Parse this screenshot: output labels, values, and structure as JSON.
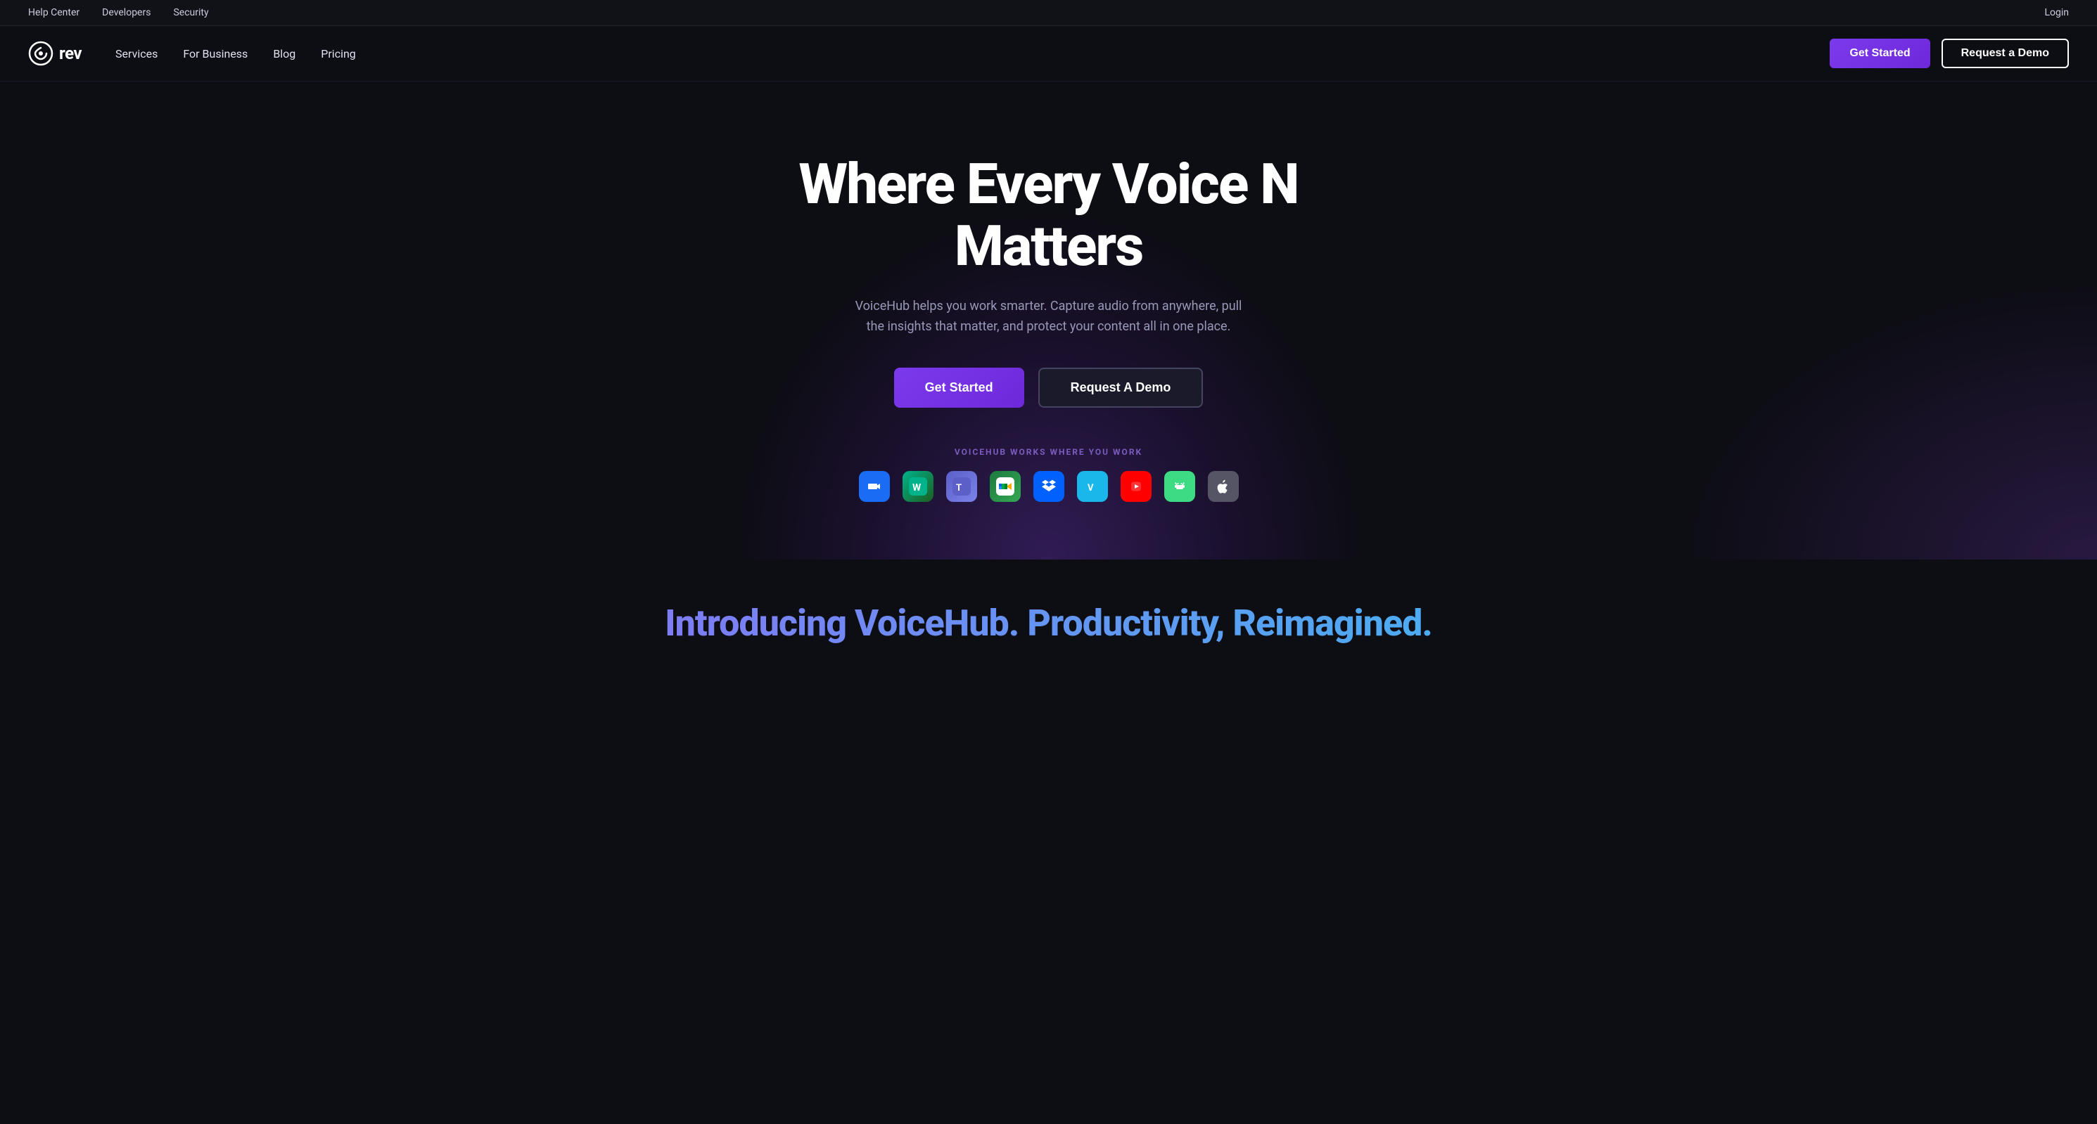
{
  "top_bar": {
    "links": [
      {
        "label": "Help Center",
        "name": "help-center-link"
      },
      {
        "label": "Developers",
        "name": "developers-link"
      },
      {
        "label": "Security",
        "name": "security-link"
      }
    ],
    "login_label": "Login"
  },
  "nav": {
    "logo_text": "rev",
    "links": [
      {
        "label": "Services",
        "name": "services-link"
      },
      {
        "label": "For Business",
        "name": "for-business-link"
      },
      {
        "label": "Blog",
        "name": "blog-link"
      },
      {
        "label": "Pricing",
        "name": "pricing-link"
      }
    ],
    "cta_primary": "Get Started",
    "cta_secondary": "Request a Demo"
  },
  "hero": {
    "title": "Where Every Voice N Matters",
    "subtitle": "VoiceHub helps you work smarter. Capture audio from anywhere, pull the insights that matter, and protect your content all in one place.",
    "btn_primary": "Get Started",
    "btn_secondary": "Request A Demo",
    "works_with_label": "VOICEHUB WORKS WHERE YOU WORK",
    "integrations": [
      {
        "name": "Zoom",
        "icon": "🎥",
        "color_class": "icon-zoom"
      },
      {
        "name": "Webex",
        "icon": "🌐",
        "color_class": "icon-webex"
      },
      {
        "name": "Microsoft Teams",
        "icon": "💬",
        "color_class": "icon-teams"
      },
      {
        "name": "Google Meet",
        "icon": "📹",
        "color_class": "icon-meet"
      },
      {
        "name": "Dropbox",
        "icon": "📦",
        "color_class": "icon-dropbox"
      },
      {
        "name": "Vimeo",
        "icon": "▶",
        "color_class": "icon-vimeo"
      },
      {
        "name": "YouTube",
        "icon": "▶",
        "color_class": "icon-youtube"
      },
      {
        "name": "Android",
        "icon": "🤖",
        "color_class": "icon-android"
      },
      {
        "name": "Apple",
        "icon": "🍎",
        "color_class": "icon-apple"
      }
    ]
  },
  "platform": {
    "title": "Introducing VoiceHub. Productivity, Reimagined."
  }
}
